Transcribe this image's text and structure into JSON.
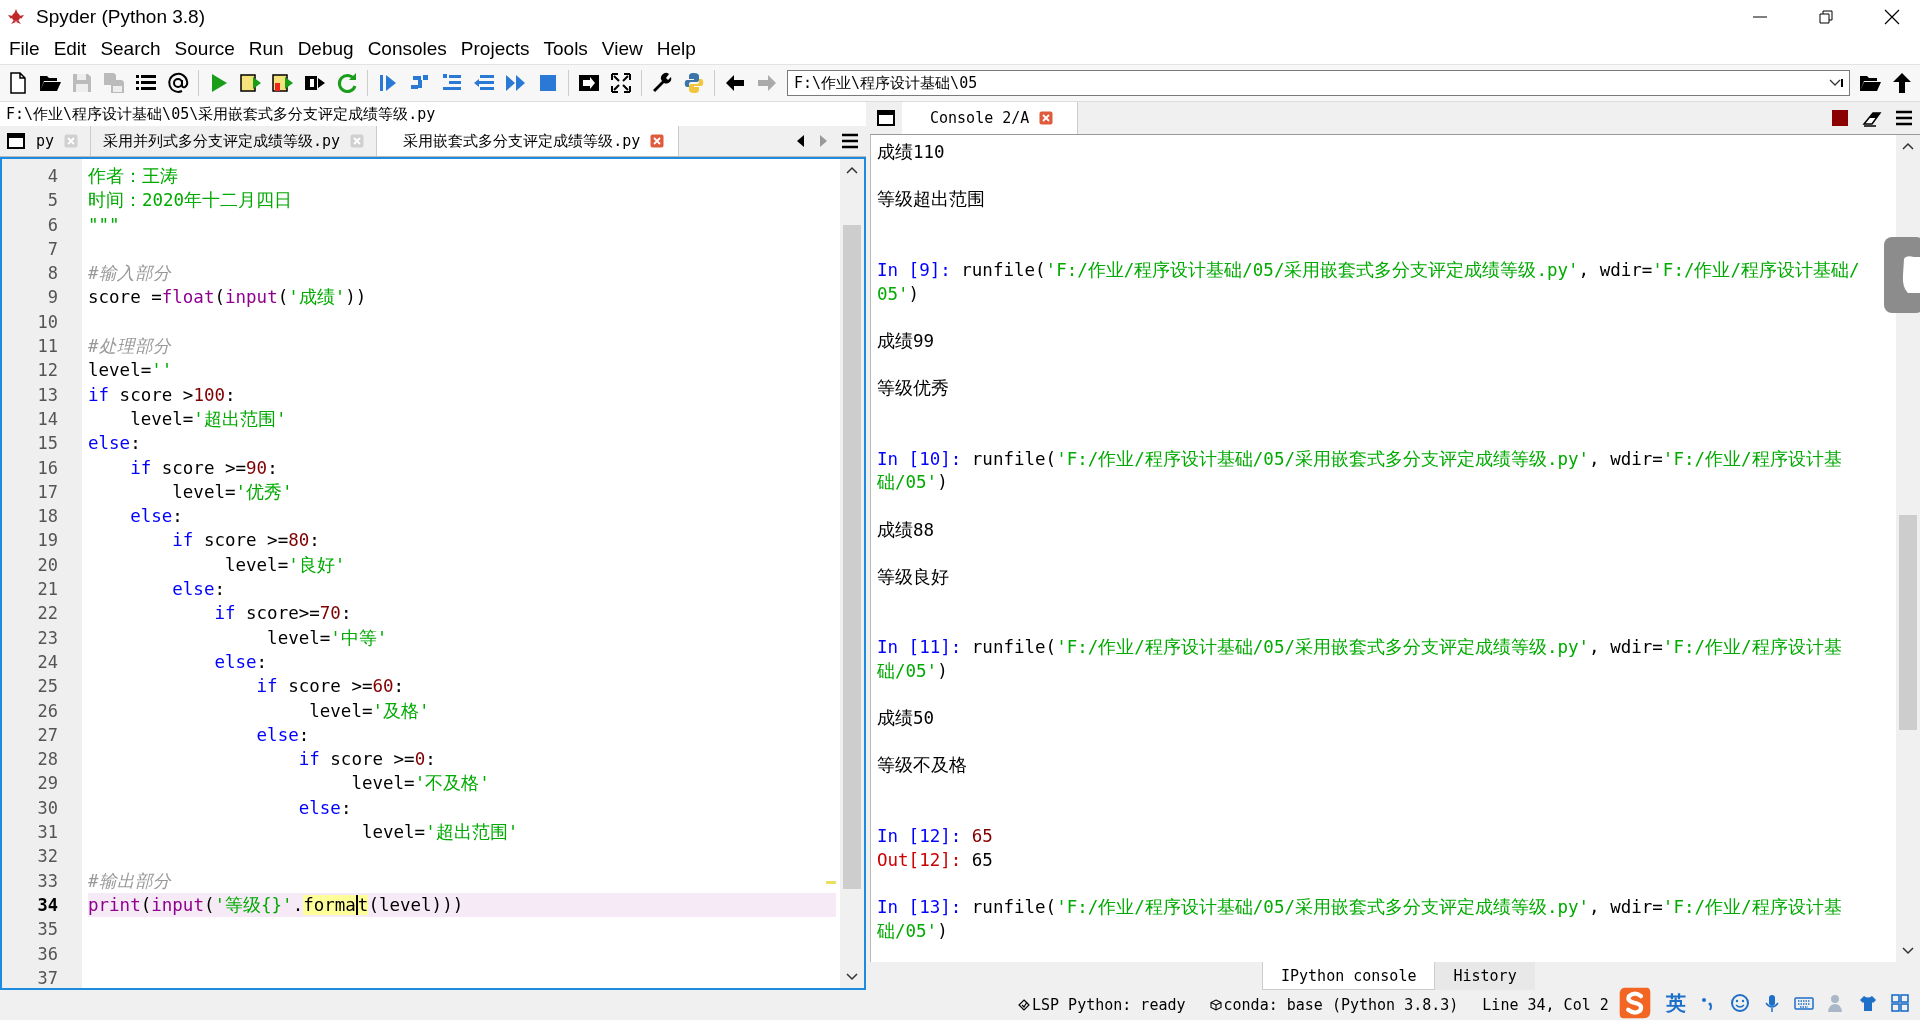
{
  "window": {
    "title": "Spyder (Python 3.8)"
  },
  "menu": [
    "File",
    "Edit",
    "Search",
    "Source",
    "Run",
    "Debug",
    "Consoles",
    "Projects",
    "Tools",
    "View",
    "Help"
  ],
  "toolbar": {
    "working_directory": "F:\\作业\\程序设计基础\\05"
  },
  "editor": {
    "file_path": "F:\\作业\\程序设计基础\\05\\采用嵌套式多分支评定成绩等级.py",
    "tabs": [
      {
        "label": "py",
        "selected": false
      },
      {
        "label": "采用并列式多分支评定成绩等级.py",
        "selected": false
      },
      {
        "label": "采用嵌套式多分支评定成绩等级.py",
        "selected": true
      }
    ],
    "lines": [
      {
        "no": "4",
        "current": false,
        "tokens": [
          {
            "kind": "str",
            "t": "作者：王涛"
          }
        ]
      },
      {
        "no": "5",
        "current": false,
        "tokens": [
          {
            "kind": "str",
            "t": "时间：2020年十二月四日"
          }
        ]
      },
      {
        "no": "6",
        "current": false,
        "tokens": [
          {
            "kind": "str",
            "t": "\"\"\""
          }
        ]
      },
      {
        "no": "7",
        "current": false
      },
      {
        "no": "8",
        "current": false,
        "tokens": [
          {
            "kind": "comment",
            "t": "#输入部分"
          }
        ]
      },
      {
        "no": "9",
        "current": false,
        "tokens": [
          {
            "kind": "plain",
            "t": "score ="
          },
          {
            "kind": "builtin",
            "t": "float"
          },
          {
            "kind": "plain",
            "t": "("
          },
          {
            "kind": "builtin",
            "t": "input"
          },
          {
            "kind": "plain",
            "t": "("
          },
          {
            "kind": "str",
            "t": "'成绩'"
          },
          {
            "kind": "plain",
            "t": "))"
          }
        ]
      },
      {
        "no": "10",
        "current": false
      },
      {
        "no": "11",
        "current": false,
        "tokens": [
          {
            "kind": "comment",
            "t": "#处理部分"
          }
        ]
      },
      {
        "no": "12",
        "current": false,
        "tokens": [
          {
            "kind": "plain",
            "t": "level="
          },
          {
            "kind": "str",
            "t": "''"
          }
        ]
      },
      {
        "no": "13",
        "current": false,
        "tokens": [
          {
            "kind": "kw",
            "t": "if"
          },
          {
            "kind": "plain",
            "t": " score >"
          },
          {
            "kind": "num",
            "t": "100"
          },
          {
            "kind": "plain",
            "t": ":"
          }
        ]
      },
      {
        "no": "14",
        "current": false,
        "tokens": [
          {
            "kind": "plain",
            "t": "    level="
          },
          {
            "kind": "str",
            "t": "'超出范围'"
          }
        ]
      },
      {
        "no": "15",
        "current": false,
        "tokens": [
          {
            "kind": "kw",
            "t": "else"
          },
          {
            "kind": "plain",
            "t": ":"
          }
        ]
      },
      {
        "no": "16",
        "current": false,
        "tokens": [
          {
            "kind": "kw",
            "t": "    if"
          },
          {
            "kind": "plain",
            "t": " score >="
          },
          {
            "kind": "num",
            "t": "90"
          },
          {
            "kind": "plain",
            "t": ":"
          }
        ]
      },
      {
        "no": "17",
        "current": false,
        "tokens": [
          {
            "kind": "plain",
            "t": "        level="
          },
          {
            "kind": "str",
            "t": "'优秀'"
          }
        ]
      },
      {
        "no": "18",
        "current": false,
        "tokens": [
          {
            "kind": "kw",
            "t": "    else"
          },
          {
            "kind": "plain",
            "t": ":"
          }
        ]
      },
      {
        "no": "19",
        "current": false,
        "tokens": [
          {
            "kind": "kw",
            "t": "        if"
          },
          {
            "kind": "plain",
            "t": " score >="
          },
          {
            "kind": "num",
            "t": "80"
          },
          {
            "kind": "plain",
            "t": ":"
          }
        ]
      },
      {
        "no": "20",
        "current": false,
        "tokens": [
          {
            "kind": "plain",
            "t": "             level="
          },
          {
            "kind": "str",
            "t": "'良好'"
          }
        ]
      },
      {
        "no": "21",
        "current": false,
        "tokens": [
          {
            "kind": "kw",
            "t": "        else"
          },
          {
            "kind": "plain",
            "t": ":"
          }
        ]
      },
      {
        "no": "22",
        "current": false,
        "tokens": [
          {
            "kind": "kw",
            "t": "            if"
          },
          {
            "kind": "plain",
            "t": " score>="
          },
          {
            "kind": "num",
            "t": "70"
          },
          {
            "kind": "plain",
            "t": ":"
          }
        ]
      },
      {
        "no": "23",
        "current": false,
        "tokens": [
          {
            "kind": "plain",
            "t": "                 level="
          },
          {
            "kind": "str",
            "t": "'中等'"
          }
        ]
      },
      {
        "no": "24",
        "current": false,
        "tokens": [
          {
            "kind": "kw",
            "t": "            else"
          },
          {
            "kind": "plain",
            "t": ":"
          }
        ]
      },
      {
        "no": "25",
        "current": false,
        "tokens": [
          {
            "kind": "kw",
            "t": "                if"
          },
          {
            "kind": "plain",
            "t": " score >="
          },
          {
            "kind": "num",
            "t": "60"
          },
          {
            "kind": "plain",
            "t": ":"
          }
        ]
      },
      {
        "no": "26",
        "current": false,
        "tokens": [
          {
            "kind": "plain",
            "t": "                     level="
          },
          {
            "kind": "str",
            "t": "'及格'"
          }
        ]
      },
      {
        "no": "27",
        "current": false,
        "tokens": [
          {
            "kind": "kw",
            "t": "                else"
          },
          {
            "kind": "plain",
            "t": ":"
          }
        ]
      },
      {
        "no": "28",
        "current": false,
        "tokens": [
          {
            "kind": "kw",
            "t": "                    if"
          },
          {
            "kind": "plain",
            "t": " score >="
          },
          {
            "kind": "num",
            "t": "0"
          },
          {
            "kind": "plain",
            "t": ":"
          }
        ]
      },
      {
        "no": "29",
        "current": false,
        "tokens": [
          {
            "kind": "plain",
            "t": "                         level="
          },
          {
            "kind": "str",
            "t": "'不及格'"
          }
        ]
      },
      {
        "no": "30",
        "current": false,
        "tokens": [
          {
            "kind": "kw",
            "t": "                    else"
          },
          {
            "kind": "plain",
            "t": ":"
          }
        ]
      },
      {
        "no": "31",
        "current": false,
        "tokens": [
          {
            "kind": "plain",
            "t": "                          level="
          },
          {
            "kind": "str",
            "t": "'超出范围'"
          }
        ]
      },
      {
        "no": "32",
        "current": false
      },
      {
        "no": "33",
        "current": false,
        "tokens": [
          {
            "kind": "comment",
            "t": "#输出部分"
          }
        ]
      },
      {
        "no": "34",
        "current": true,
        "tokens": [
          {
            "kind": "builtin",
            "t": "print"
          },
          {
            "kind": "plain",
            "t": "("
          },
          {
            "kind": "builtin",
            "t": "input"
          },
          {
            "kind": "plain",
            "t": "("
          },
          {
            "kind": "str",
            "t": "'等级{}'"
          },
          {
            "kind": "plain",
            "t": "."
          },
          {
            "kind": "match",
            "t": "forma",
            "caret_after": true
          },
          {
            "kind": "match",
            "t": "t"
          },
          {
            "kind": "plain",
            "t": "(level)))"
          }
        ]
      },
      {
        "no": "35",
        "current": false
      },
      {
        "no": "36",
        "current": false
      },
      {
        "no": "37",
        "current": false
      }
    ]
  },
  "console": {
    "tabs": [
      {
        "label": "Console 2/A",
        "selected": true
      }
    ],
    "entries": [
      {
        "kind": "output",
        "text": "成绩110"
      },
      {
        "kind": "output",
        "text": "等级超出范围"
      },
      {
        "kind": "input",
        "tokens": [
          {
            "kind": "prompt_in",
            "t": "In [9]: "
          },
          {
            "kind": "plain",
            "t": "runfile("
          },
          {
            "kind": "str",
            "t": "'F:/作业/程序设计基础/05/采用嵌套式多分支评定成绩等级.py'"
          },
          {
            "kind": "plain",
            "t": ", wdir="
          },
          {
            "kind": "str",
            "t": "'F:/作业/程序设计基础/05'"
          },
          {
            "kind": "plain",
            "t": ")"
          }
        ]
      },
      {
        "kind": "output",
        "text": "成绩99"
      },
      {
        "kind": "output",
        "text": "等级优秀"
      },
      {
        "kind": "input",
        "tokens": [
          {
            "kind": "prompt_in",
            "t": "In [10]: "
          },
          {
            "kind": "plain",
            "t": "runfile("
          },
          {
            "kind": "str",
            "t": "'F:/作业/程序设计基础/05/采用嵌套式多分支评定成绩等级.py'"
          },
          {
            "kind": "plain",
            "t": ", wdir="
          },
          {
            "kind": "str",
            "t": "'F:/作业/程序设计基础/05'"
          },
          {
            "kind": "plain",
            "t": ")"
          }
        ]
      },
      {
        "kind": "output",
        "text": "成绩88"
      },
      {
        "kind": "output",
        "text": "等级良好"
      },
      {
        "kind": "input",
        "tokens": [
          {
            "kind": "prompt_in",
            "t": "In [11]: "
          },
          {
            "kind": "plain",
            "t": "runfile("
          },
          {
            "kind": "str",
            "t": "'F:/作业/程序设计基础/05/采用嵌套式多分支评定成绩等级.py'"
          },
          {
            "kind": "plain",
            "t": ", wdir="
          },
          {
            "kind": "str",
            "t": "'F:/作业/程序设计基础/05'"
          },
          {
            "kind": "plain",
            "t": ")"
          }
        ]
      },
      {
        "kind": "output",
        "text": "成绩50"
      },
      {
        "kind": "output",
        "text": "等级不及格"
      },
      {
        "kind": "echo",
        "tokens": [
          {
            "kind": "prompt_in",
            "t": "In [12]: "
          },
          {
            "kind": "num",
            "t": "65"
          }
        ]
      },
      {
        "kind": "result",
        "tokens": [
          {
            "kind": "prompt_out",
            "t": "Out[12]: "
          },
          {
            "kind": "plain",
            "t": "65"
          }
        ]
      },
      {
        "kind": "input",
        "tokens": [
          {
            "kind": "prompt_in",
            "t": "In [13]: "
          },
          {
            "kind": "plain",
            "t": "runfile("
          },
          {
            "kind": "str",
            "t": "'F:/作业/程序设计基础/05/采用嵌套式多分支评定成绩等级.py'"
          },
          {
            "kind": "plain",
            "t": ", wdir="
          },
          {
            "kind": "str",
            "t": "'F:/作业/程序设计基础/05'"
          },
          {
            "kind": "plain",
            "t": ")"
          }
        ]
      }
    ]
  },
  "bottom_tabs": [
    {
      "label": "IPython console",
      "selected": true
    },
    {
      "label": "History",
      "selected": false
    }
  ],
  "status_bar": {
    "lsp": "LSP Python: ready",
    "conda": "conda: base (Python 3.8.3)",
    "position": "Line 34, Col 2"
  },
  "input_method": {
    "language": "英"
  }
}
